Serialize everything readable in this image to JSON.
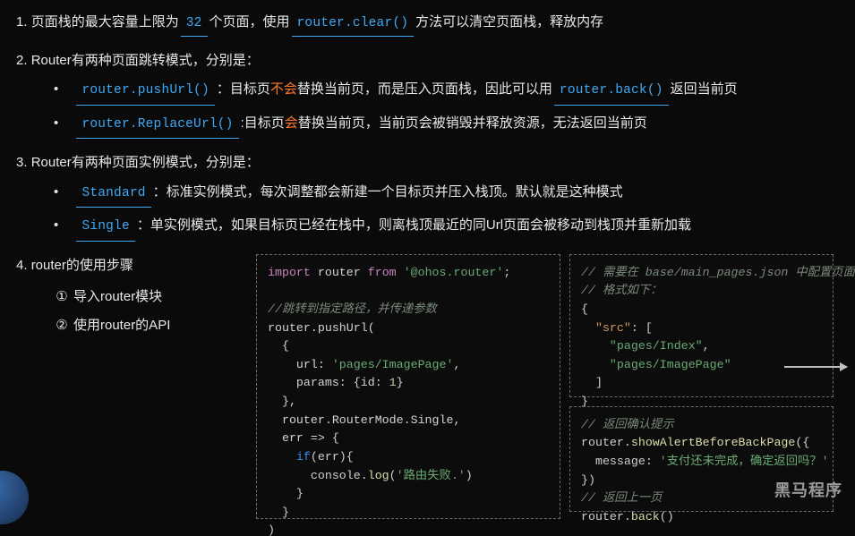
{
  "item1": {
    "num": "1.",
    "t1": "页面栈的最大容量上限为",
    "b1": "32",
    "t2": "个页面，使用",
    "b2": "router.clear()",
    "t3": "方法可以清空页面栈，释放内存"
  },
  "item2": {
    "num": "2.",
    "title": "Router有两种页面跳转模式，分别是：",
    "sub1": {
      "b1": "router.pushUrl()",
      "t1": "：目标页",
      "kw": "不会",
      "t2": "替换当前页，而是压入页面栈，因此可以用",
      "b2": "router.back()",
      "t3": "返回当前页"
    },
    "sub2": {
      "b1": "router.ReplaceUrl()",
      "t1": ":目标页",
      "kw": "会",
      "t2": "替换当前页，当前页会被销毁并释放资源，无法返回当前页"
    }
  },
  "item3": {
    "num": "3.",
    "title": "Router有两种页面实例模式，分别是：",
    "sub1": {
      "b1": "Standard",
      "t1": "：标准实例模式，每次调整都会新建一个目标页并压入栈顶。默认就是这种模式"
    },
    "sub2": {
      "b1": "Single",
      "t1": "：单实例模式，如果目标页已经在栈中，则离栈顶最近的同Url页面会被移动到栈顶并重新加载"
    }
  },
  "item4": {
    "num": "4.",
    "title": "router的使用步骤",
    "step1": {
      "n": "①",
      "t": "导入router模块"
    },
    "step2": {
      "n": "②",
      "t": "使用router的API"
    }
  },
  "codeA": {
    "l1a": "import",
    "l1b": " router ",
    "l1c": "from",
    "l1d": " '@ohos.router'",
    "l1e": ";",
    "l3": "//跳转到指定路径，并传递参数",
    "l4": "router.pushUrl(",
    "l5": "  {",
    "l6a": "    url: ",
    "l6b": "'pages/ImagePage'",
    "l6c": ",",
    "l7a": "    params: {id: ",
    "l7b": "1",
    "l7c": "}",
    "l8": "  },",
    "l9": "  router.RouterMode.Single,",
    "l10": "  err => {",
    "l11a": "    ",
    "l11b": "if",
    "l11c": "(err){",
    "l12a": "      console.",
    "l12b": "log",
    "l12c": "(",
    "l12d": "'路由失败.'",
    "l12e": ")",
    "l13": "    }",
    "l14": "  }",
    "l15": ")"
  },
  "codeB": {
    "l1": "// 需要在 base/main_pages.json 中配置页面",
    "l2": "// 格式如下：",
    "l3": "{",
    "l4a": "  ",
    "l4b": "\"src\"",
    "l4c": ": [",
    "l5a": "    ",
    "l5b": "\"pages/Index\"",
    "l5c": ",",
    "l6a": "    ",
    "l6b": "\"pages/ImagePage\"",
    "l7": "  ]",
    "l8": "}"
  },
  "codeC": {
    "l1": "// 返回确认提示",
    "l2a": "router.",
    "l2b": "showAlertBeforeBackPage",
    "l2c": "({",
    "l3a": "  message: ",
    "l3b": "'支付还未完成，确定返回吗？'",
    "l4": "})",
    "l5": "// 返回上一页",
    "l6a": "router.",
    "l6b": "back",
    "l6c": "()"
  },
  "watermark": "黑马程序"
}
